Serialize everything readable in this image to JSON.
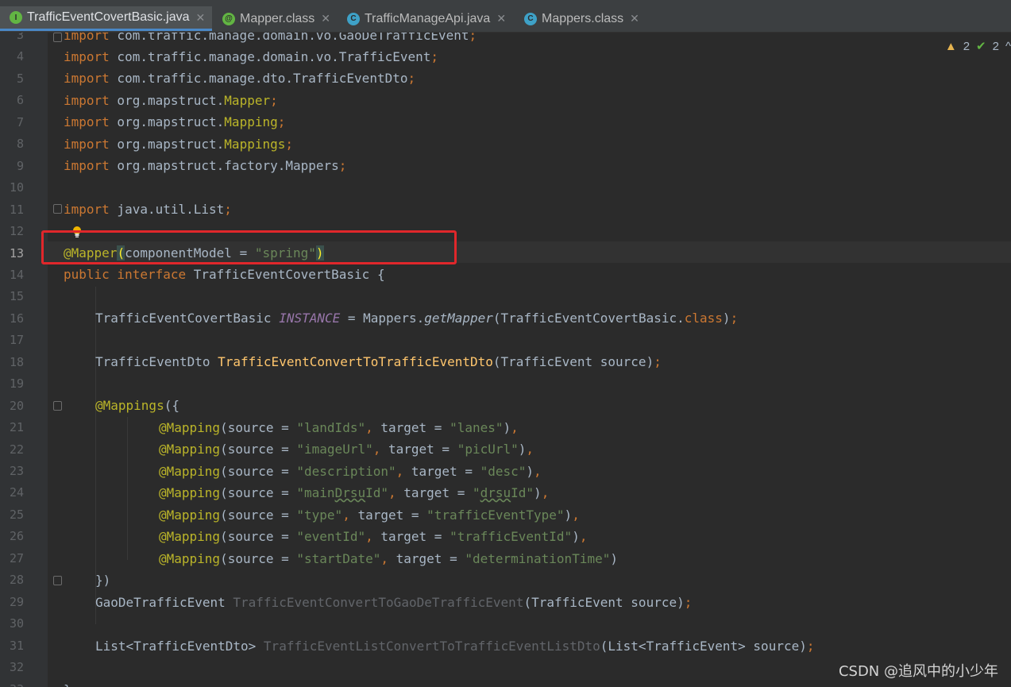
{
  "tabs": [
    {
      "label": "TrafficEventCovertBasic.java",
      "icon": "interface-icon",
      "icon_letter": "I",
      "close": "✕",
      "active": true
    },
    {
      "label": "Mapper.class",
      "icon": "annotation-icon",
      "icon_letter": "@",
      "close": "✕",
      "active": false
    },
    {
      "label": "TrafficManageApi.java",
      "icon": "class-icon",
      "icon_letter": "C",
      "close": "✕",
      "active": false
    },
    {
      "label": "Mappers.class",
      "icon": "class-icon",
      "icon_letter": "C",
      "close": "✕",
      "active": false
    }
  ],
  "inspection": {
    "warnings": "2",
    "weak_warnings": "2"
  },
  "current_line": "13",
  "lines": [
    {
      "n": "3",
      "text": "import com.traffic.manage.domain.vo.GaoDeTrafficEvent;"
    },
    {
      "n": "4",
      "text": "import com.traffic.manage.domain.vo.TrafficEvent;"
    },
    {
      "n": "5",
      "text": "import com.traffic.manage.dto.TrafficEventDto;"
    },
    {
      "n": "6",
      "text": "import org.mapstruct.Mapper;"
    },
    {
      "n": "7",
      "text": "import org.mapstruct.Mapping;"
    },
    {
      "n": "8",
      "text": "import org.mapstruct.Mappings;"
    },
    {
      "n": "9",
      "text": "import org.mapstruct.factory.Mappers;"
    },
    {
      "n": "10",
      "text": ""
    },
    {
      "n": "11",
      "text": "import java.util.List;"
    },
    {
      "n": "12",
      "text": ""
    },
    {
      "n": "13",
      "text": "@Mapper(componentModel = \"spring\")"
    },
    {
      "n": "14",
      "text": "public interface TrafficEventCovertBasic {"
    },
    {
      "n": "15",
      "text": ""
    },
    {
      "n": "16",
      "text": "TrafficEventCovertBasic INSTANCE = Mappers.getMapper(TrafficEventCovertBasic.class);"
    },
    {
      "n": "17",
      "text": ""
    },
    {
      "n": "18",
      "text": "TrafficEventDto TrafficEventConvertToTrafficEventDto(TrafficEvent source);"
    },
    {
      "n": "19",
      "text": ""
    },
    {
      "n": "20",
      "text": "@Mappings({"
    },
    {
      "n": "21",
      "text": "@Mapping(source = \"landIds\", target = \"lanes\"),"
    },
    {
      "n": "22",
      "text": "@Mapping(source = \"imageUrl\", target = \"picUrl\"),"
    },
    {
      "n": "23",
      "text": "@Mapping(source = \"description\", target = \"desc\"),"
    },
    {
      "n": "24",
      "text": "@Mapping(source = \"mainDrsuId\", target = \"drsuId\"),"
    },
    {
      "n": "25",
      "text": "@Mapping(source = \"type\", target = \"trafficEventType\"),"
    },
    {
      "n": "26",
      "text": "@Mapping(source = \"eventId\", target = \"trafficEventId\"),"
    },
    {
      "n": "27",
      "text": "@Mapping(source = \"startDate\", target = \"determinationTime\")"
    },
    {
      "n": "28",
      "text": "})"
    },
    {
      "n": "29",
      "text": "GaoDeTrafficEvent TrafficEventConvertToGaoDeTrafficEvent(TrafficEvent source);"
    },
    {
      "n": "30",
      "text": ""
    },
    {
      "n": "31",
      "text": "List<TrafficEventDto> TrafficEventListConvertToTrafficEventListDto(List<TrafficEvent> source);"
    },
    {
      "n": "32",
      "text": ""
    },
    {
      "n": "33",
      "text": "}"
    }
  ],
  "watermark": "CSDN @追风中的小少年",
  "colors": {
    "background": "#2b2b2b",
    "keyword": "#cc7832",
    "annotation": "#bbb529",
    "string": "#6a8759",
    "method": "#ffc66d",
    "highlight_box": "#e0272b"
  }
}
